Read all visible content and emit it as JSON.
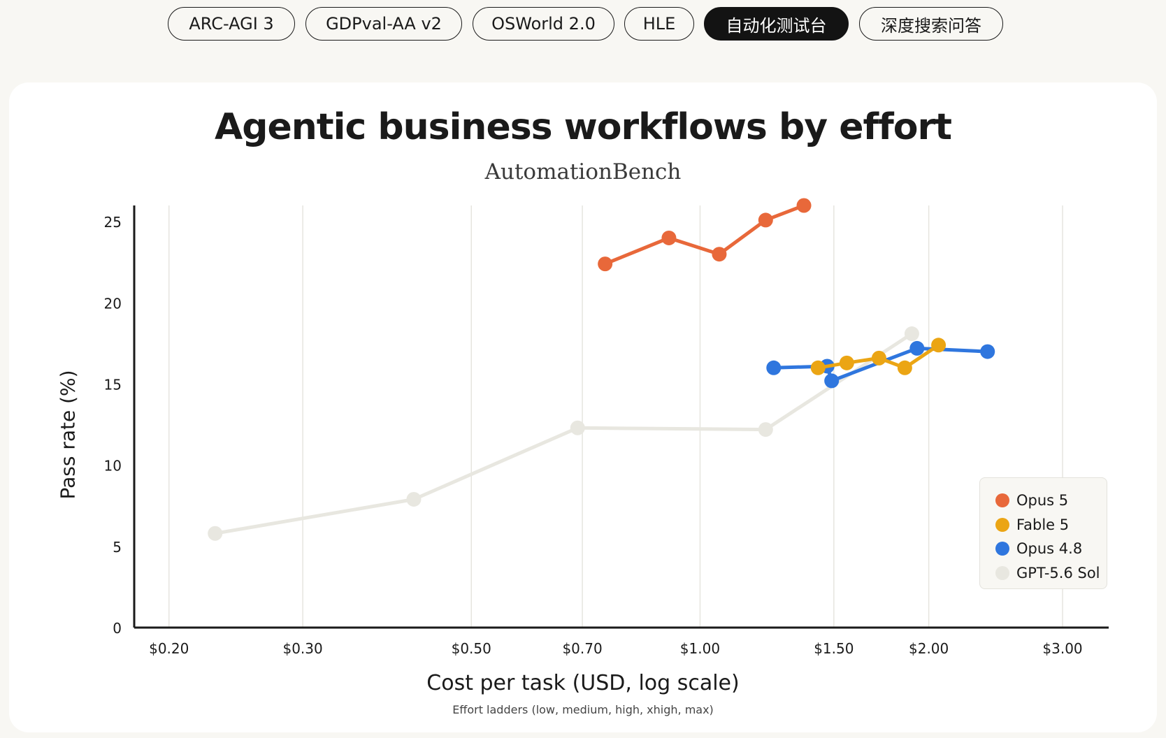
{
  "tabs": [
    {
      "label": "ARC-AGI 3",
      "active": false
    },
    {
      "label": "GDPval-AA v2",
      "active": false
    },
    {
      "label": "OSWorld 2.0",
      "active": false
    },
    {
      "label": "HLE",
      "active": false
    },
    {
      "label": "自动化测试台",
      "active": true
    },
    {
      "label": "深度搜索问答",
      "active": false
    }
  ],
  "colors": {
    "Opus 5": "#e8683a",
    "Fable 5": "#eba514",
    "Opus 4.8": "#2f76de",
    "GPT-5.6 Sol": "#e8e7e0",
    "gridline": "#e6e5df",
    "axis": "#1a1a1a"
  },
  "chart_data": {
    "type": "line",
    "title": "Agentic business workflows by effort",
    "subtitle": "AutomationBench",
    "xlabel": "Cost per task (USD, log scale)",
    "xnote": "Effort ladders (low, medium, high, xhigh, max)",
    "ylabel": "Pass rate (%)",
    "x_scale": "log",
    "xlim": [
      0.18,
      3.45
    ],
    "ylim": [
      0,
      26
    ],
    "x_ticks": [
      0.2,
      0.3,
      0.5,
      0.7,
      1.0,
      1.5,
      2.0,
      3.0
    ],
    "x_tick_labels": [
      "$0.20",
      "$0.30",
      "$0.50",
      "$0.70",
      "$1.00",
      "$1.50",
      "$2.00",
      "$3.00"
    ],
    "y_ticks": [
      0,
      5,
      10,
      15,
      20,
      25
    ],
    "y_tick_labels": [
      "0",
      "5",
      "10",
      "15",
      "20",
      "25"
    ],
    "grid": "vertical",
    "legend_position": "bottom-right",
    "series": [
      {
        "name": "GPT-5.6 Sol",
        "x": [
          0.23,
          0.42,
          0.69,
          1.22,
          1.9
        ],
        "y": [
          5.8,
          7.9,
          12.3,
          12.2,
          18.1
        ]
      },
      {
        "name": "Opus 4.8",
        "x": [
          1.25,
          1.47,
          1.49,
          1.93,
          2.39
        ],
        "y": [
          16.0,
          16.1,
          15.2,
          17.2,
          17.0
        ]
      },
      {
        "name": "Fable 5",
        "x": [
          1.43,
          1.56,
          1.72,
          1.86,
          2.06
        ],
        "y": [
          16.0,
          16.3,
          16.6,
          16.0,
          17.4
        ]
      },
      {
        "name": "Opus 5",
        "x": [
          0.75,
          0.91,
          1.06,
          1.22,
          1.37
        ],
        "y": [
          22.4,
          24.0,
          23.0,
          25.1,
          26.0
        ]
      }
    ],
    "legend": [
      "Opus 5",
      "Fable 5",
      "Opus 4.8",
      "GPT-5.6 Sol"
    ]
  }
}
